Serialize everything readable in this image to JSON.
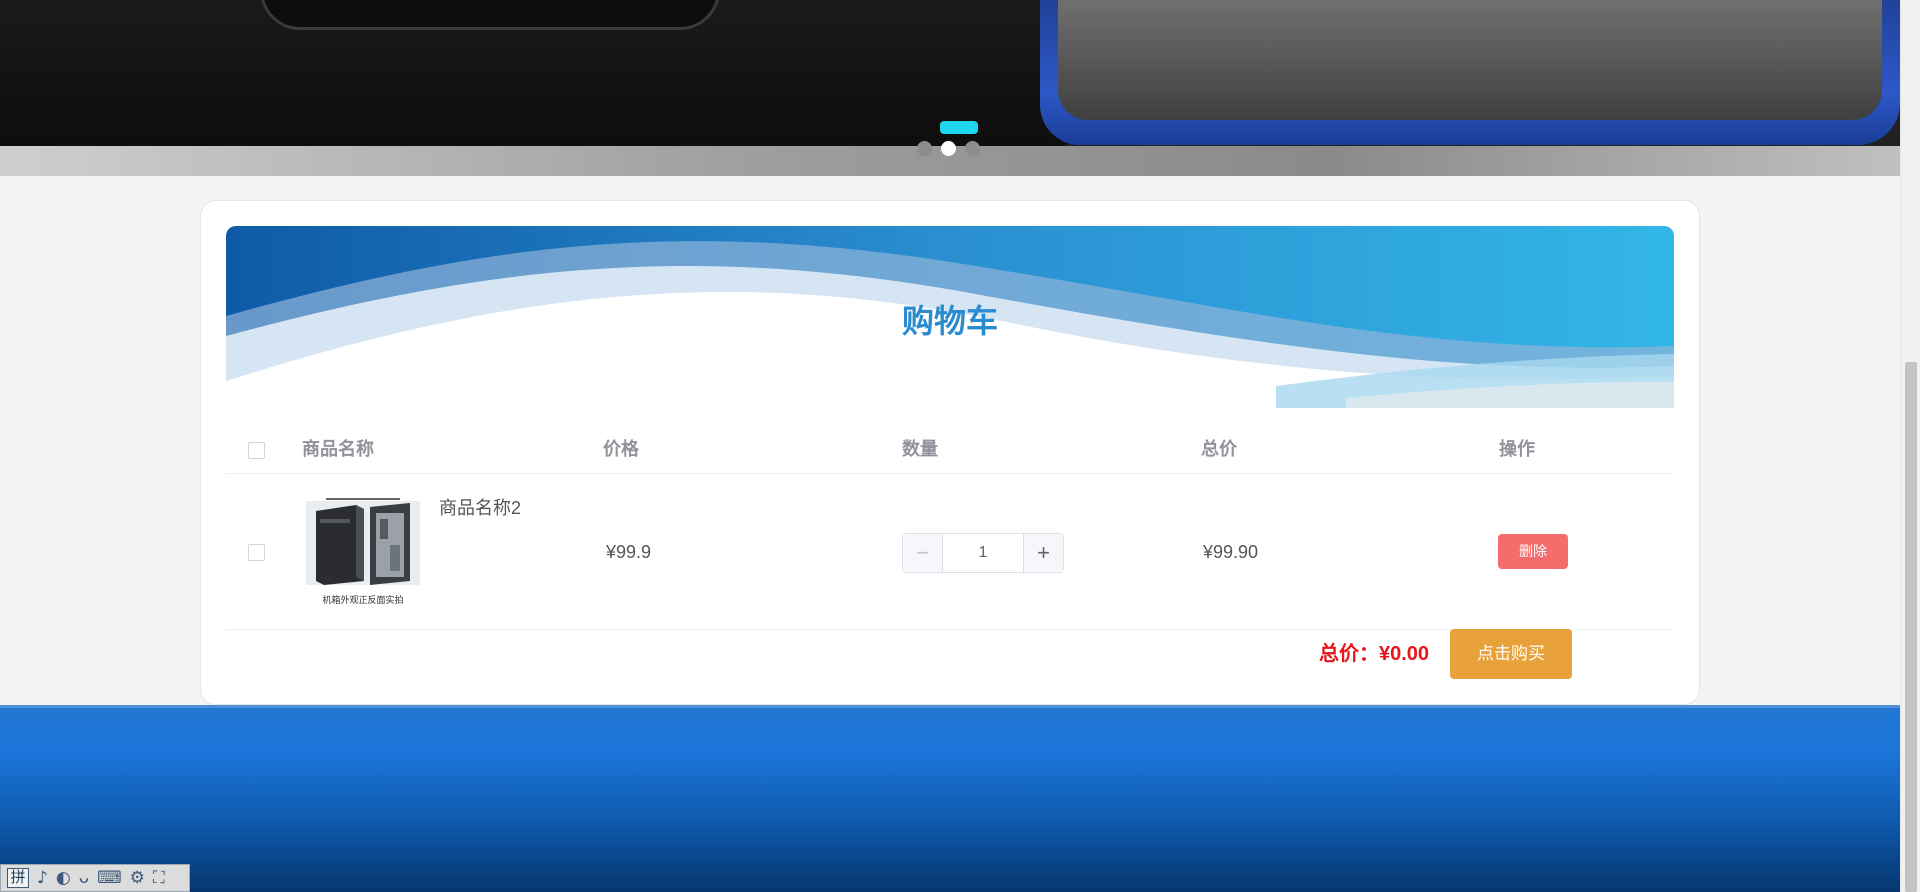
{
  "banner": {
    "active_slide": 2,
    "slide_count": 3
  },
  "cart": {
    "title": "购物车",
    "columns": {
      "name": "商品名称",
      "price": "价格",
      "quantity": "数量",
      "total": "总价",
      "action": "操作"
    },
    "items": [
      {
        "name": "商品名称2",
        "image_caption": "机箱外观正反面实拍",
        "price": "¥99.9",
        "quantity": "1",
        "total": "¥99.90",
        "delete_label": "删除"
      }
    ],
    "summary": {
      "total_label": "总价：",
      "total_value": "¥0.00",
      "buy_label": "点击购买"
    }
  },
  "ime_toolbar": {
    "mode_label": "拼"
  },
  "colors": {
    "title": "#2a8bd0",
    "delete": "#f56c6c",
    "buy": "#e9a23b",
    "total": "#e8141b",
    "indicator": "#1ed7ec"
  }
}
